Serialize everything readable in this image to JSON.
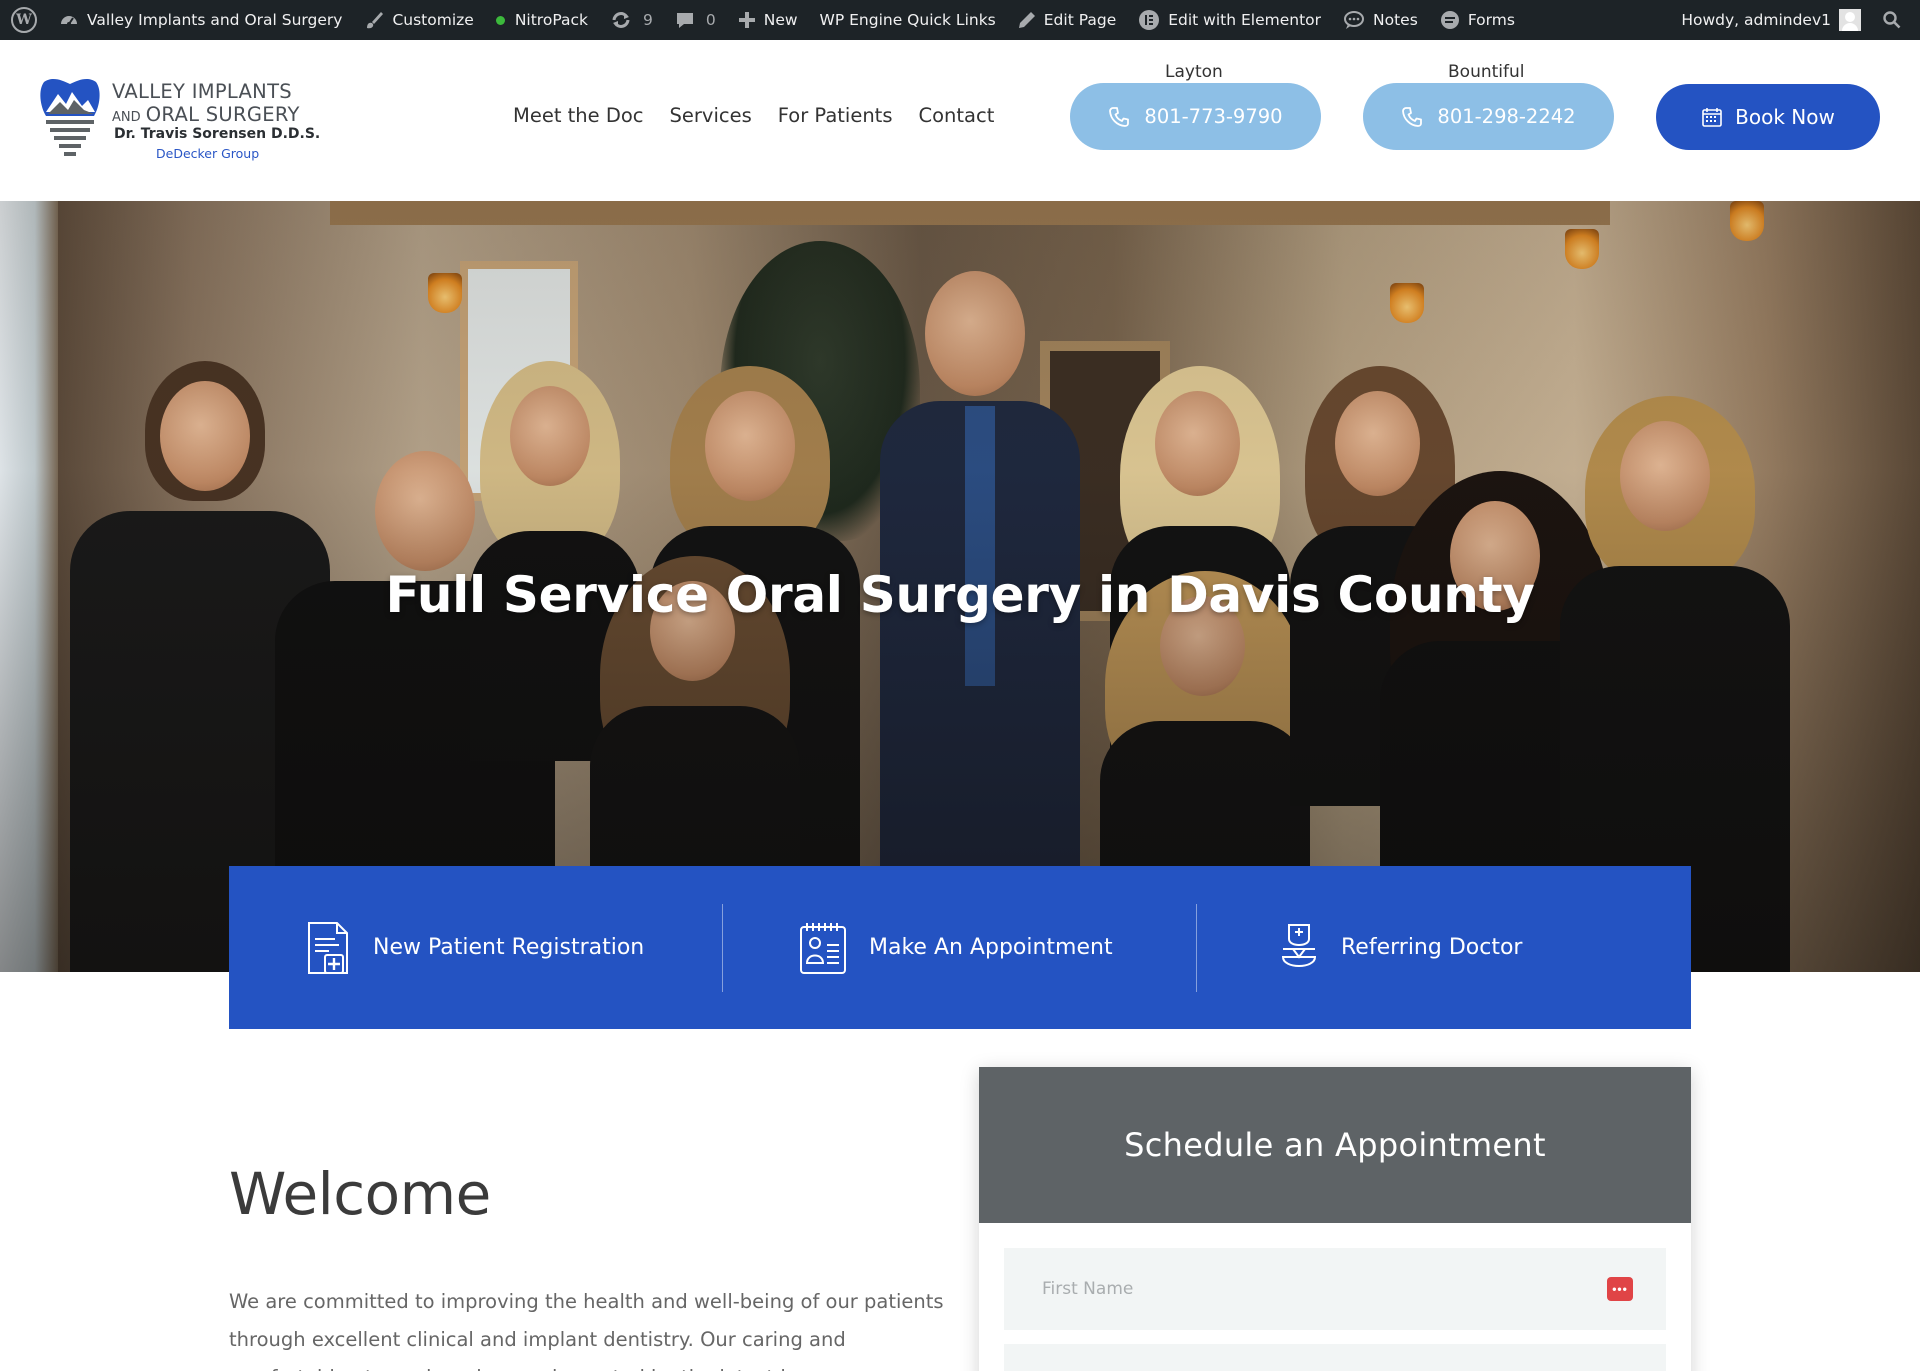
{
  "admin_bar": {
    "site_name": "Valley Implants and Oral Surgery",
    "customize": "Customize",
    "nitropack": "NitroPack",
    "updates_count": "9",
    "comments_count": "0",
    "new": "New",
    "wp_engine": "WP Engine Quick Links",
    "edit_page": "Edit Page",
    "edit_elementor": "Edit with Elementor",
    "notes": "Notes",
    "forms": "Forms",
    "howdy": "Howdy, admindev1"
  },
  "logo": {
    "line1": "VALLEY IMPLANTS",
    "line2_and": "AND",
    "line2_main": "ORAL SURGERY",
    "line3": "Dr. Travis Sorensen D.D.S.",
    "line4": "DeDecker Group"
  },
  "nav": {
    "items": [
      {
        "label": "Meet the Doc"
      },
      {
        "label": "Services"
      },
      {
        "label": "For Patients"
      },
      {
        "label": "Contact"
      }
    ]
  },
  "locations": {
    "layton": {
      "label": "Layton",
      "phone": "801-773-9790"
    },
    "bountiful": {
      "label": "Bountiful",
      "phone": "801-298-2242"
    }
  },
  "book_now": "Book Now",
  "hero": {
    "title": "Full Service Oral Surgery in Davis County"
  },
  "quick_links": [
    {
      "label": "New Patient Registration",
      "icon": "registration-form-icon"
    },
    {
      "label": "Make An Appointment",
      "icon": "appointment-calendar-icon"
    },
    {
      "label": "Referring Doctor",
      "icon": "doctor-icon"
    }
  ],
  "welcome": {
    "title": "Welcome",
    "body": "We are committed to improving the health and well-being of our patients through excellent clinical and implant dentistry. Our caring and comfortable atmosphere is complemented by the latest in"
  },
  "appointment": {
    "title": "Schedule an Appointment",
    "first_name_placeholder": "First Name",
    "first_name_value": ""
  },
  "colors": {
    "admin_bar": "#1d2327",
    "brand_blue": "#2453c2",
    "phone_button": "#8dbfe6",
    "form_header": "#5e6366"
  }
}
